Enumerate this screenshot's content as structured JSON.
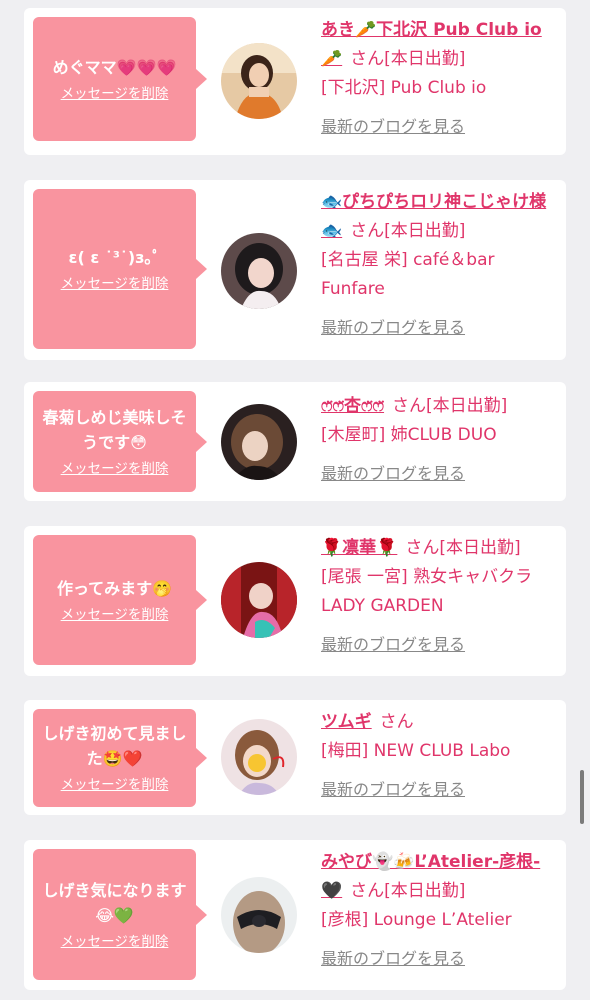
{
  "colors": {
    "accent": "#e0356a",
    "bubble": "#f9949f",
    "link_gray": "#888888",
    "background": "#efeff2"
  },
  "entries": [
    {
      "message": "めぐママ💗💗💗",
      "delete_label": "メッセージを削除",
      "name": "あき🥕下北沢 Pub Club io🥕",
      "honorific": "さん",
      "status": "[本日出勤]",
      "shop": "[下北沢] Pub Club io",
      "blog_label": "最新のブログを見る"
    },
    {
      "message": "ε( ε ˙³˙)з｡ﾟ",
      "delete_label": "メッセージを削除",
      "name": "🐟ぴちぴちロリ神こじゃけ様🐟",
      "honorific": "さん",
      "status": "[本日出勤]",
      "shop": "[名古屋 栄] café＆bar Funfare",
      "blog_label": "最新のブログを見る"
    },
    {
      "message": "春菊しめじ美味しそうです😳",
      "delete_label": "メッセージを削除",
      "name": "ෆ̈ෆ̈杏ෆ̈ෆ̈",
      "honorific": "さん",
      "status": "[本日出勤]",
      "shop": "[木屋町] 姉CLUB DUO",
      "blog_label": "最新のブログを見る"
    },
    {
      "message": "作ってみます🤭",
      "delete_label": "メッセージを削除",
      "name": "🌹凛華🌹",
      "honorific": "さん",
      "status": "[本日出勤]",
      "shop": "[尾張 一宮] 熟女キャバクラ LADY GARDEN",
      "blog_label": "最新のブログを見る"
    },
    {
      "message": "しげき初めて見ました🤩❤️",
      "delete_label": "メッセージを削除",
      "name": "ツムギ",
      "honorific": "さん",
      "status": "",
      "shop": "[梅田] NEW CLUB Labo",
      "blog_label": "最新のブログを見る"
    },
    {
      "message": "しげき気になります😂💚",
      "delete_label": "メッセージを削除",
      "name": "みやび👻🍻L’Atelier-彦根-🖤",
      "honorific": "さん",
      "status": "[本日出勤]",
      "shop": "[彦根] Lounge L’Atelier",
      "blog_label": "最新のブログを見る"
    }
  ]
}
